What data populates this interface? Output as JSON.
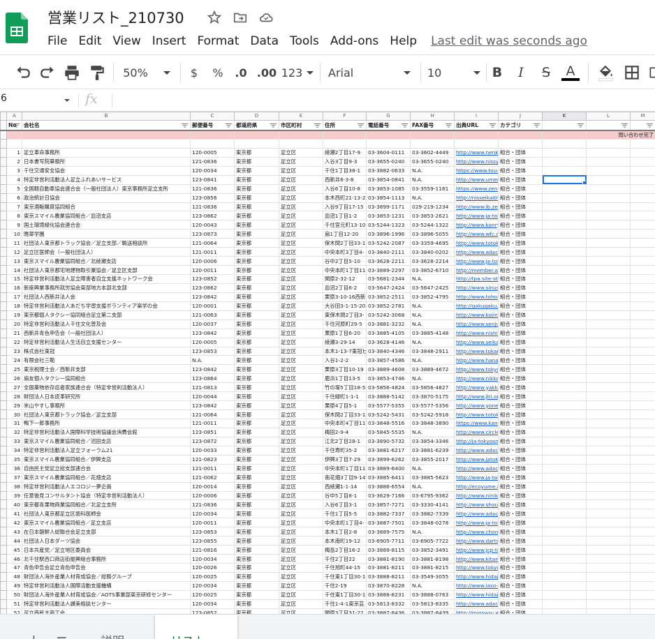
{
  "app": {
    "doc_title": "営業リスト_210730",
    "menus": [
      "File",
      "Edit",
      "View",
      "Insert",
      "Format",
      "Data",
      "Tools",
      "Add-ons",
      "Help"
    ],
    "last_edit": "Last edit was seconds ago",
    "icons": [
      "star-icon",
      "move-to-folder-icon",
      "cloud-status-icon"
    ]
  },
  "toolbar": {
    "zoom": "50%",
    "currency": "$",
    "percent": "%",
    "decrease_decimal": ".0",
    "increase_decimal": ".00",
    "more_formats": "123",
    "font": "Arial",
    "font_size": "10",
    "bold": "B",
    "italic": "I",
    "strike": "S",
    "text_color": "A"
  },
  "formula_bar": {
    "name_box": "6",
    "fx": "fx"
  },
  "columns": [
    "A",
    "B",
    "C",
    "D",
    "E",
    "F",
    "G",
    "H",
    "I",
    "J",
    "K",
    "L",
    "M"
  ],
  "selected_column": "K",
  "headers": [
    "No",
    "会社名",
    "郵便番号",
    "都道府県",
    "市区町村",
    "住所",
    "電話番号",
    "FAX番号",
    "出典URL",
    "カテゴリ"
  ],
  "status_label": "問い合わせ完了",
  "rows": [
    {
      "no": "1",
      "name": "足立革命事務所",
      "zip": "120-0005",
      "pref": "東京都",
      "city": "足立区",
      "addr": "綾瀬2丁目17-9",
      "tel": "03-3604-0111",
      "fax": "03-3602-4449",
      "url": "http://www.nenkin",
      "cat": "組合・団体"
    },
    {
      "no": "2",
      "name": "日本書写院華務所",
      "zip": "121-0836",
      "pref": "東京都",
      "city": "足立区",
      "addr": "入谷3丁目9-3",
      "tel": "03-3655-0240",
      "fax": "03-3655-0240",
      "url": "http://www.nissyo",
      "cat": "組合・団体"
    },
    {
      "no": "3",
      "name": "千住交通安全協会",
      "zip": "120-0034",
      "pref": "東京都",
      "city": "足立区",
      "addr": "千住1丁目38-1",
      "tel": "03-3882-0633",
      "fax": "N.A.",
      "url": "https://www.tou-kc",
      "cat": "組合・団体"
    },
    {
      "no": "4",
      "name": "特定非営利活動法人足立ふれあいサービス",
      "zip": "123-0841",
      "pref": "東京都",
      "city": "足立区",
      "addr": "西新井6-3-8",
      "tel": "03-3854-0841",
      "fax": "N.A.",
      "url": "http://www.umeni",
      "cat": "組合・団体"
    },
    {
      "no": "5",
      "name": "全国軽自動車協会連合会（一般社団法人）東京事務所足立支所",
      "zip": "121-0836",
      "pref": "東京都",
      "city": "足立区",
      "addr": "入谷6丁目10-8",
      "tel": "03-3853-1085",
      "fax": "03-3559-1161",
      "url": "https://www.zenk",
      "cat": "組合・団体"
    },
    {
      "no": "6",
      "name": "政治統計日協会",
      "zip": "123-0856",
      "pref": "東京都",
      "city": "足立区",
      "addr": "本木西町21-13-2",
      "tel": "03-3854-1113",
      "fax": "N.A.",
      "url": "http://nisseikai00",
      "cat": "組合・団体"
    },
    {
      "no": "7",
      "name": "東京酒販購買協同組合",
      "zip": "121-0836",
      "pref": "東京都",
      "city": "足立区",
      "addr": "入谷9丁目17-15",
      "tel": "03-3899-1171",
      "fax": "029-219-1234",
      "url": "http://www.ib.zen",
      "cat": "組合・団体"
    },
    {
      "no": "8",
      "name": "東京スマイル農業協同組合／皿沼支店",
      "zip": "123-0862",
      "pref": "東京都",
      "city": "足立区",
      "addr": "皿沼1丁目1-2",
      "tel": "03-3853-1231",
      "fax": "03-3853-2621",
      "url": "http://www.ja-tok",
      "cat": "組合・団体"
    },
    {
      "no": "9",
      "name": "国土環境緑化協会連合会",
      "zip": "120-0043",
      "pref": "東京都",
      "city": "足立区",
      "addr": "千住宮元町13-10",
      "tel": "03-5244-1323",
      "fax": "03-5244-1322",
      "url": "http://www.kanry",
      "cat": "組合・団体"
    },
    {
      "no": "10",
      "name": "晩翠学園",
      "zip": "123-0873",
      "pref": "東京都",
      "city": "足立区",
      "addr": "扇1丁目12-20",
      "tel": "03-3896-1996",
      "fax": "03-3896-5055",
      "url": "http://www.wfc.o",
      "cat": "組合・団体"
    },
    {
      "no": "11",
      "name": "社団法人東京都トラック協会／足立支部／輸送相談所",
      "zip": "121-0064",
      "pref": "東京都",
      "city": "足立区",
      "addr": "保木間2丁目33-1",
      "tel": "03-5242-2087",
      "fax": "03-3359-4695",
      "url": "http://www.totoku",
      "cat": "組合・団体"
    },
    {
      "no": "12",
      "name": "足立区医師会（一般社団法人）",
      "zip": "121-0011",
      "pref": "東京都",
      "city": "足立区",
      "addr": "中央本町3丁目4-",
      "tel": "03-3840-2111",
      "fax": "03-3840-0202",
      "url": "http://www.adach",
      "cat": "組合・団体"
    },
    {
      "no": "13",
      "name": "東京スマイル農業協同組合／北綾瀬支店",
      "zip": "120-0006",
      "pref": "東京都",
      "city": "足立区",
      "addr": "谷中2丁目5-10",
      "tel": "03-3628-2211",
      "fax": "03-3628-2214",
      "url": "http://www.ja-tok",
      "cat": "組合・団体"
    },
    {
      "no": "14",
      "name": "社団法人東京都宅地建物取引業協会／足立区支部",
      "zip": "120-0011",
      "pref": "東京都",
      "city": "足立区",
      "addr": "中央本町1丁目11",
      "tel": "03-3889-2297",
      "fax": "03-3852-6710",
      "url": "http://member.ad",
      "cat": "組合・団体"
    },
    {
      "no": "15",
      "name": "特定非営利活動法人足立障害者自立支援ネットワーク会",
      "zip": "123-0852",
      "pref": "東京都",
      "city": "足立区",
      "addr": "関原2-32-12",
      "tel": "03-5681-2344",
      "fax": "N.A.",
      "url": "http://tpa.site-sta",
      "cat": "組合・団体"
    },
    {
      "no": "16",
      "name": "新座興業事務所就労協会東部地方本部北支部",
      "zip": "123-0862",
      "pref": "東京都",
      "city": "足立区",
      "addr": "皿沼2丁目6-2",
      "tel": "03-5647-2424",
      "fax": "03-5647-2425",
      "url": "http://www.sinus",
      "cat": "組合・団体"
    },
    {
      "no": "17",
      "name": "社団法人西新井法人会",
      "zip": "123-0842",
      "pref": "東京都",
      "city": "足立区",
      "addr": "栗原3-10-16西新",
      "tel": "03-3852-2511",
      "fax": "03-3852-4795",
      "url": "http://www.tohon",
      "cat": "組合・団体"
    },
    {
      "no": "18",
      "name": "特定非営利活動法人あだち学習支援ボランティア楽学の会",
      "zip": "120-0001",
      "pref": "東京都",
      "city": "足立区",
      "addr": "大谷田3-1-15-20",
      "tel": "03-3852-2781",
      "fax": "N.A.",
      "url": "http://gakugaku.",
      "cat": "組合・団体"
    },
    {
      "no": "19",
      "name": "東京都個人タクシー協同組合足立第二支部",
      "zip": "121-0063",
      "pref": "東京都",
      "city": "足立区",
      "addr": "東保木間2丁目3-",
      "tel": "03-5242-3068",
      "fax": "N.A.",
      "url": "http://www.kojint",
      "cat": "組合・団体"
    },
    {
      "no": "20",
      "name": "特定非営利活動法人千住文化普及会",
      "zip": "120-0037",
      "pref": "東京都",
      "city": "足立区",
      "addr": "千住河原町29-5",
      "tel": "03-3881-3232",
      "fax": "N.A.",
      "url": "http://www.senju",
      "cat": "組合・団体"
    },
    {
      "no": "21",
      "name": "西新井青色申告会（一般社団法人）",
      "zip": "123-0842",
      "pref": "東京都",
      "city": "足立区",
      "addr": "栗原1丁目6-20",
      "tel": "03-3885-4105",
      "fax": "03-3885-4148",
      "url": "http://www.nishia",
      "cat": "組合・団体"
    },
    {
      "no": "22",
      "name": "特定非営利活動法人生活自立支援センター",
      "zip": "120-0005",
      "pref": "東京都",
      "city": "足立区",
      "addr": "綾瀬3-29-14",
      "tel": "03-3628-4146",
      "fax": "N.A.",
      "url": "http://www.seikat",
      "cat": "組合・団体"
    },
    {
      "no": "23",
      "name": "株式会社東冠",
      "zip": "123-0853",
      "pref": "東京都",
      "city": "足立区",
      "addr": "本木1-13-7東冠ビ",
      "tel": "03-3840-4346",
      "fax": "03-3848-2911",
      "url": "http://www.tokan",
      "cat": "組合・団体"
    },
    {
      "no": "24",
      "name": "有限会社三範",
      "zip": "N.A.",
      "pref": "東京都",
      "city": "足立区",
      "addr": "入谷1-2-2",
      "tel": "03-3857-4586",
      "fax": "N.A.",
      "url": "http://www.hanai",
      "cat": "組合・団体"
    },
    {
      "no": "25",
      "name": "東京税理士会／西新井支部",
      "zip": "123-0842",
      "pref": "東京都",
      "city": "足立区",
      "addr": "栗原3丁目10-19",
      "tel": "03-3889-4608",
      "fax": "03-3889-4672",
      "url": "http://www.tokyo",
      "cat": "組合・団体"
    },
    {
      "no": "26",
      "name": "扇友個人タクシー協同組合",
      "zip": "123-0864",
      "pref": "東京都",
      "city": "足立区",
      "addr": "鹿浜1丁目13-5",
      "tel": "03-3853-4746",
      "fax": "N.A.",
      "url": "http://www.nikko",
      "cat": "組合・団体"
    },
    {
      "no": "27",
      "name": "全国薬物依存症者家族連合会（特定非営利活動法人）",
      "zip": "121-0813",
      "pref": "東京都",
      "city": "足立区",
      "addr": "竹の塚5丁目18-5",
      "tel": "03-5856-4824",
      "fax": "03-5856-4827",
      "url": "http://www.yakka",
      "cat": "組合・団体"
    },
    {
      "no": "28",
      "name": "財団法人日本皮革研究所",
      "zip": "120-0044",
      "pref": "東京都",
      "city": "足立区",
      "addr": "千住緑町1-1-1",
      "tel": "03-3888-5142",
      "fax": "03-3870-5175",
      "url": "http://www.jlri.or",
      "cat": "組合・団体"
    },
    {
      "no": "29",
      "name": "米山やすし事務所",
      "zip": "123-0842",
      "pref": "東京都",
      "city": "足立区",
      "addr": "栗原4丁目5-1",
      "tel": "03-5577-5355",
      "fax": "03-5577-5356",
      "url": "http://www.yone",
      "cat": "組合・団体"
    },
    {
      "no": "30",
      "name": "社団法人東京都トラック協会／足立支部",
      "zip": "121-0064",
      "pref": "東京都",
      "city": "足立区",
      "addr": "保木間2丁目33-1",
      "tel": "03-5242-5431",
      "fax": "03-5242-5918",
      "url": "http://www.totoku",
      "cat": "組合・団体"
    },
    {
      "no": "31",
      "name": "鴨下一郎事務所",
      "zip": "121-0011",
      "pref": "東京都",
      "city": "足立区",
      "addr": "中央本町4丁目11",
      "tel": "03-3848-5516",
      "fax": "03-3848-3890",
      "url": "https://www.kamo",
      "cat": "組合・団体"
    },
    {
      "no": "32",
      "name": "特定非営利活動法人国際科学技術協議会消費会館",
      "zip": "123-0851",
      "pref": "東京都",
      "city": "足立区",
      "addr": "梅田2-9-4",
      "tel": "03-5845-5535",
      "fax": "N.A.",
      "url": "http://www.circle",
      "cat": "組合・団体"
    },
    {
      "no": "33",
      "name": "東京スマイル農業協同組合／沼田支店",
      "zip": "123-0872",
      "pref": "東京都",
      "city": "足立区",
      "addr": "江北2丁目28-1",
      "tel": "03-3890-5732",
      "fax": "03-3854-3346",
      "url": "http://ja-tokyosn",
      "cat": "組合・団体"
    },
    {
      "no": "34",
      "name": "特定非営利活動法人足立フォーラム21",
      "zip": "120-0033",
      "pref": "東京都",
      "city": "足立区",
      "addr": "千住寿町35-2",
      "tel": "03-3881-6217",
      "fax": "03-3881-6239",
      "url": "http://www.adach",
      "cat": "組合・団体"
    },
    {
      "no": "35",
      "name": "東京スマイル農業協同組合／伊興支店",
      "zip": "121-0823",
      "pref": "東京都",
      "city": "足立区",
      "addr": "伊興3丁目7-29",
      "tel": "03-3899-6262",
      "fax": "03-3855-2017",
      "url": "http://www.jatoky",
      "cat": "組合・団体"
    },
    {
      "no": "36",
      "name": "自由民主党足立総支部連合会",
      "zip": "121-0011",
      "pref": "東京都",
      "city": "足立区",
      "addr": "中央本町1丁目11",
      "tel": "03-3889-6400",
      "fax": "N.A.",
      "url": "http://www.adach",
      "cat": "組合・団体"
    },
    {
      "no": "37",
      "name": "東京スマイル農業協同組合／花畑支店",
      "zip": "121-0062",
      "pref": "東京都",
      "city": "足立区",
      "addr": "南花畑3丁目9-14",
      "tel": "03-3885-6411",
      "fax": "03-3885-5623",
      "url": "http://www.ja-tok",
      "cat": "組合・団体"
    },
    {
      "no": "38",
      "name": "特定非営利活動法人エコロジー夢企画",
      "zip": "120-0014",
      "pref": "東京都",
      "city": "足立区",
      "addr": "西綾瀬1-1-14",
      "tel": "03-3886-6554",
      "fax": "N.A.",
      "url": "http://ecoyume.n",
      "cat": "組合・団体"
    },
    {
      "no": "39",
      "name": "任意後見コンサルタント協会（特定非営利活動法人）",
      "zip": "120-0006",
      "pref": "東京都",
      "city": "足立区",
      "addr": "谷中5丁目8-1",
      "tel": "03-3629-7166",
      "fax": "03-6795-9362",
      "url": "http://www.niniko",
      "cat": "組合・団体"
    },
    {
      "no": "40",
      "name": "東京都青果物商業協同組合／北足立支所",
      "zip": "121-0836",
      "pref": "東京都",
      "city": "足立区",
      "addr": "入谷6丁目3-1",
      "tel": "03-3857-7271",
      "fax": "03-3330-4141",
      "url": "http://www.shoul",
      "cat": "組合・団体"
    },
    {
      "no": "41",
      "name": "社団法人東京都足立区歯科医師会",
      "zip": "120-0034",
      "pref": "東京都",
      "city": "足立区",
      "addr": "千住1丁目5-5",
      "tel": "03-3882-7337",
      "fax": "03-3882-7339",
      "url": "http://www.adach",
      "cat": "組合・団体"
    },
    {
      "no": "42",
      "name": "東京スマイル農業協同組合／足立支店",
      "zip": "120-0011",
      "pref": "東京都",
      "city": "足立区",
      "addr": "中央本町1丁目4-",
      "tel": "03-3887-7501",
      "fax": "03-3848-0278",
      "url": "http://www.ja-tok",
      "cat": "組合・団体"
    },
    {
      "no": "43",
      "name": "在日本朝鮮人総聯合会足立支部",
      "zip": "123-0853",
      "pref": "東京都",
      "city": "足立区",
      "addr": "本木1丁目2-8",
      "tel": "03-3889-7575",
      "fax": "N.A.",
      "url": "http://www.chong",
      "cat": "組合・団体"
    },
    {
      "no": "44",
      "name": "社団法人日本ダーツ協会",
      "zip": "123-0855",
      "pref": "東京都",
      "city": "足立区",
      "addr": "本木南町19-12",
      "tel": "03-6905-7711",
      "fax": "03-6905-7722",
      "url": "http://www.darts",
      "cat": "組合・団体"
    },
    {
      "no": "45",
      "name": "日本共産党／足立地区委員会",
      "zip": "121-0816",
      "pref": "東京都",
      "city": "足立区",
      "addr": "梅島2丁目16-2",
      "tel": "03-3889-8115",
      "fax": "03-3852-3491",
      "url": "http://www.jcp-to",
      "cat": "組合・団体"
    },
    {
      "no": "46",
      "name": "北千住駅西口商店街振興組合事務所",
      "zip": "120-0034",
      "pref": "東京都",
      "city": "足立区",
      "addr": "千住2丁目22",
      "tel": "03-3881-8190",
      "fax": "03-3881-8198",
      "url": "http://www.kitaro",
      "cat": "組合・団体"
    },
    {
      "no": "47",
      "name": "青色申告会足立青色申告会",
      "zip": "120-0026",
      "pref": "東京都",
      "city": "足立区",
      "addr": "千住旭町44-15",
      "tel": "03-3881-8211",
      "fax": "03-3881-8215",
      "url": "http://www.tokyo",
      "cat": "組合・団体"
    },
    {
      "no": "48",
      "name": "財団法人海外産業人材育成協会／総務グループ",
      "zip": "120-0025",
      "pref": "東京都",
      "city": "足立区",
      "addr": "千住東1丁目30-1",
      "tel": "03-3888-8211",
      "fax": "03-3549-3055",
      "url": "http://www.hidajo",
      "cat": "組合・団体"
    },
    {
      "no": "49",
      "name": "特定非営利活動法人国際活動支援機構",
      "zip": "120-0034",
      "pref": "東京都",
      "city": "足立区",
      "addr": "千住2-19",
      "tel": "03-3870-8228",
      "fax": "N.A.",
      "url": "http://www.iaso-j",
      "cat": "組合・団体"
    },
    {
      "no": "50",
      "name": "財団法人海外産業人材育成協会／AOTS事業部東京研修センター",
      "zip": "120-0025",
      "pref": "東京都",
      "city": "足立区",
      "addr": "千住東1丁目30-1",
      "tel": "03-3888-8231",
      "fax": "03-3888-0763",
      "url": "http://www.hidajo",
      "cat": "組合・団体"
    },
    {
      "no": "51",
      "name": "特定非営利活動法人讃美相談センター",
      "zip": "120-0034",
      "pref": "東京都",
      "city": "足立区",
      "addr": "千住1-4-1東京芸",
      "tel": "03-5813-8332",
      "fax": "03-5813-8335",
      "url": "http://www.adach",
      "cat": "組合・団体"
    },
    {
      "no": "52",
      "name": "足立西民主商工会",
      "zip": "123-0852",
      "pref": "東京都",
      "city": "足立区",
      "addr": "関原3丁目31-22",
      "tel": "03-3887-8436",
      "fax": "03-3887-8439",
      "url": "http://minsyou.w",
      "cat": "組合・団体"
    }
  ],
  "sheet_tabs": {
    "add": "+",
    "all": "≡",
    "tab1": "説明",
    "tab2": "リスト"
  }
}
